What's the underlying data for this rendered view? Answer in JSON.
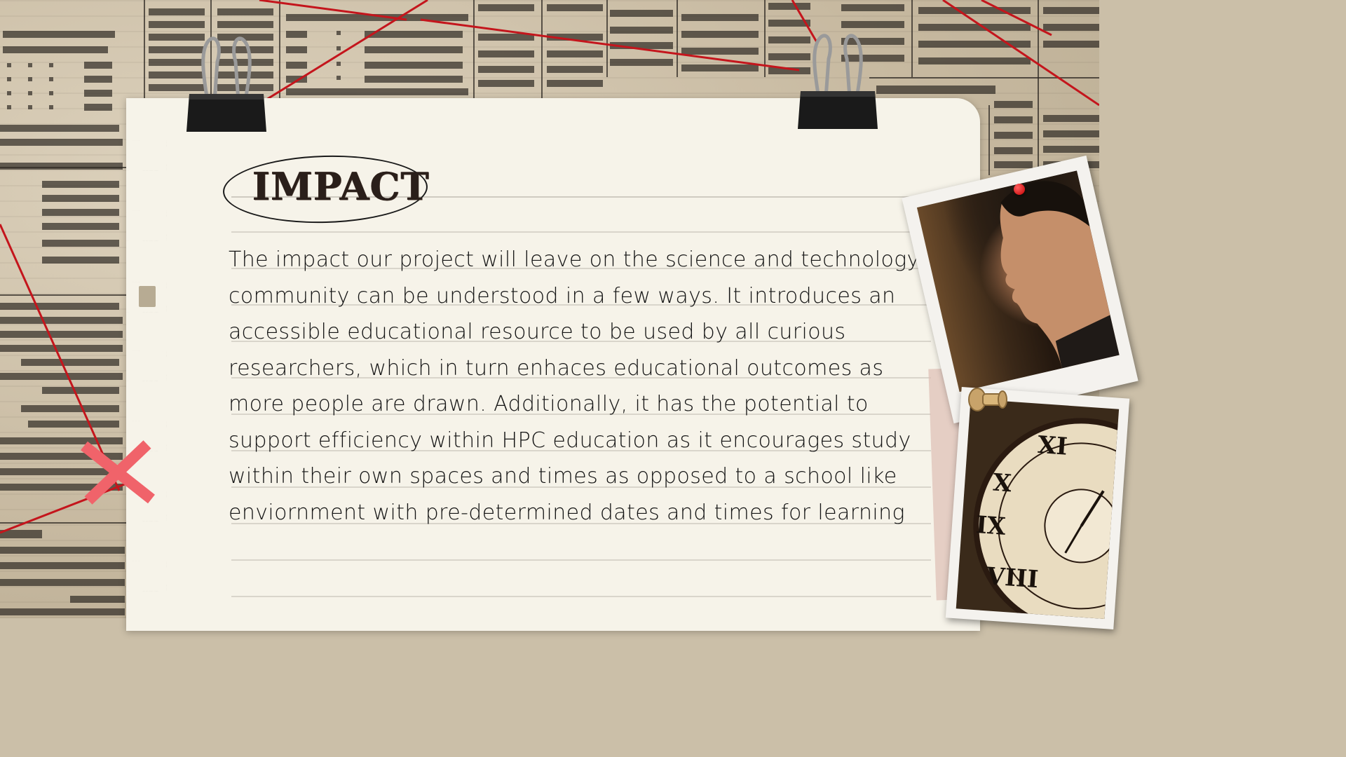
{
  "slide": {
    "title": "IMPACT",
    "body": "The impact our project will leave on the science and technology community can be understood in a few ways. It introduces an accessible educational resource to be used by all curious researchers, which in turn enhaces educational outcomes as more people are drawn. Additionally, it has the potential to support efficiency within HPC education as it encourages study within their own spaces and times as opposed to a school like enviornment with pre-determined dates and times for learning"
  },
  "colors": {
    "paper": "#f6f3e9",
    "string_red": "#c4151c",
    "x_mark": "#f0636a",
    "text": "#141414"
  },
  "icons": {
    "clips": "binder-clip-icon",
    "pin_top": "push-pin-icon",
    "pin_mid": "thumbtack-icon",
    "x": "x-mark-icon"
  }
}
